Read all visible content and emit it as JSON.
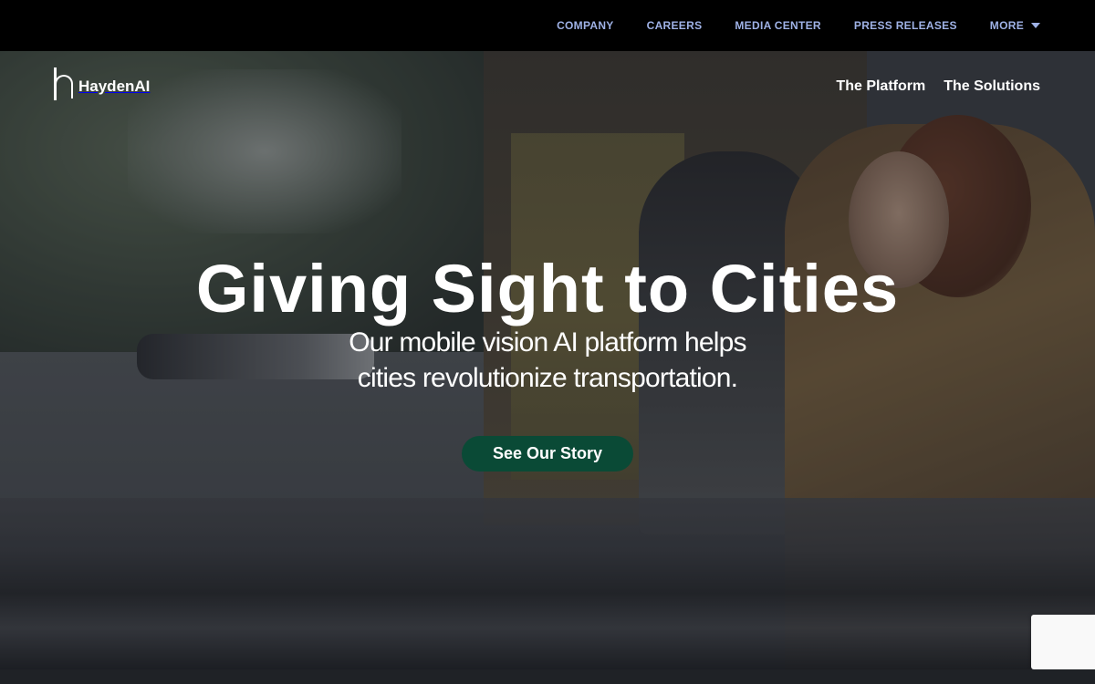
{
  "topnav": {
    "items": [
      {
        "label": "COMPANY"
      },
      {
        "label": "CAREERS"
      },
      {
        "label": "MEDIA CENTER"
      },
      {
        "label": "PRESS RELEASES"
      },
      {
        "label": "MORE"
      }
    ]
  },
  "header": {
    "brand": "HaydenAI",
    "nav": [
      {
        "label": "The Platform"
      },
      {
        "label": "The Solutions"
      }
    ]
  },
  "hero": {
    "title": "Giving Sight to Cities",
    "subtitle_line1": "Our mobile vision AI platform helps",
    "subtitle_line2": "cities revolutionize transportation.",
    "cta_label": "See Our Story"
  },
  "colors": {
    "topbar_bg": "#000000",
    "topnav_text": "#9fb2e6",
    "cta_bg": "#0a4a36"
  },
  "icons": {
    "brand_logo": "hayden-logo-icon",
    "more_dropdown": "caret-down-icon"
  }
}
